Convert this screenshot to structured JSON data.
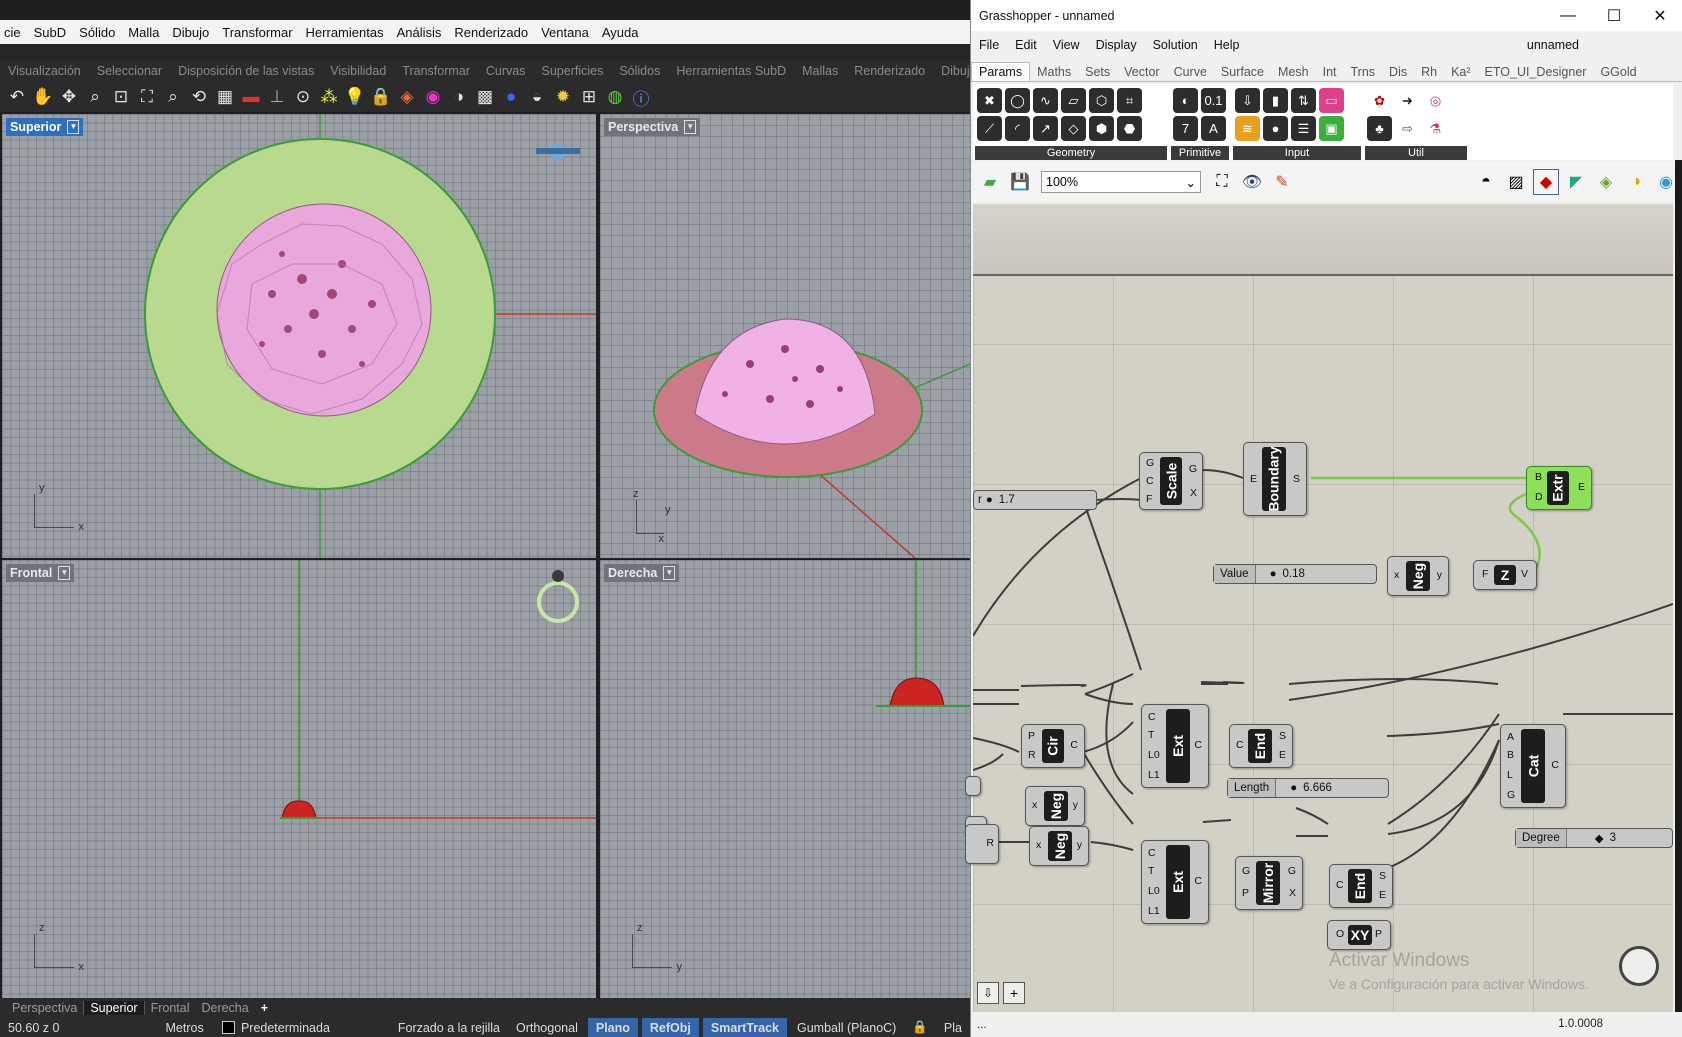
{
  "rhino": {
    "menu": [
      "cie",
      "SubD",
      "Sólido",
      "Malla",
      "Dibujo",
      "Transformar",
      "Herramientas",
      "Análisis",
      "Renderizado",
      "Ventana",
      "Ayuda"
    ],
    "toolbar_tabs": [
      "Visualización",
      "Seleccionar",
      "Disposición de las vistas",
      "Visibilidad",
      "Transformar",
      "Curvas",
      "Superficies",
      "Sólidos",
      "Herramientas SubD",
      "Mallas",
      "Renderizado",
      "Dibujo"
    ],
    "viewports": {
      "top": {
        "label": "Superior",
        "axis_y": "y",
        "axis_x": "x"
      },
      "perspective": {
        "label": "Perspectiva",
        "axis_z": "z",
        "axis_y": "y",
        "axis_x": "x"
      },
      "front": {
        "label": "Frontal",
        "axis_z": "z",
        "axis_x": "x"
      },
      "right": {
        "label": "Derecha",
        "axis_z": "z",
        "axis_y": "y"
      }
    },
    "bottom_tabs": [
      "Perspectiva",
      "Superior",
      "Frontal",
      "Derecha"
    ],
    "add_tab": "+",
    "status": {
      "coords": "50.60  z 0",
      "units": "Metros",
      "layer": "Predeterminada",
      "grid_snap": "Forzado a la rejilla",
      "ortho": "Orthogonal",
      "planar": "Plano",
      "osnap": "RefObj",
      "smarttrack": "SmartTrack",
      "gumball": "Gumball (PlanoC)",
      "tail": "Pla"
    },
    "colors": {
      "active_viewport": "#2f6fc0",
      "status_highlight": "#3365a8",
      "flower": "#e9a8dc",
      "disc": "#b9d98e"
    }
  },
  "gh": {
    "title": "Grasshopper - unnamed",
    "doc_name": "unnamed",
    "menu": [
      "File",
      "Edit",
      "View",
      "Display",
      "Solution",
      "Help"
    ],
    "tabs": [
      "Params",
      "Maths",
      "Sets",
      "Vector",
      "Curve",
      "Surface",
      "Mesh",
      "Int",
      "Trns",
      "Dis",
      "Rh",
      "Ka²",
      "ETO_UI_Designer",
      "GGold"
    ],
    "ribbon_groups": [
      "Geometry",
      "Primitive",
      "Input",
      "Util"
    ],
    "zoom": "100%",
    "nodes": {
      "scale": {
        "name": "Scale",
        "in": [
          "G",
          "C",
          "F"
        ],
        "out": [
          "G",
          "X"
        ]
      },
      "boundary": {
        "name": "Boundary",
        "in": [
          "E"
        ],
        "out": [
          "S"
        ]
      },
      "extr": {
        "name": "Extr",
        "in": [
          "B",
          "D"
        ],
        "out": [
          "E"
        ]
      },
      "neg1": {
        "name": "Neg",
        "in": [
          "x"
        ],
        "out": [
          "y"
        ]
      },
      "unitz": {
        "name": "Z",
        "in": [
          "F"
        ],
        "out": [
          "V"
        ]
      },
      "circle": {
        "name": "Cir",
        "in": [
          "P",
          "R"
        ],
        "out": [
          "C"
        ]
      },
      "ext1": {
        "name": "Ext",
        "in": [
          "C",
          "T",
          "L0",
          "L1"
        ],
        "out": [
          "C"
        ]
      },
      "end1": {
        "name": "End",
        "in": [
          "C"
        ],
        "out": [
          "S",
          "E"
        ]
      },
      "cat": {
        "name": "Cat",
        "in": [
          "A",
          "B",
          "L",
          "G"
        ],
        "out": [
          "C"
        ]
      },
      "neg2": {
        "name": "Neg",
        "in": [
          "x"
        ],
        "out": [
          "y"
        ]
      },
      "ext2": {
        "name": "Ext",
        "in": [
          "C",
          "T",
          "L0",
          "L1"
        ],
        "out": [
          "C"
        ]
      },
      "mirror": {
        "name": "Mirror",
        "in": [
          "G",
          "P"
        ],
        "out": [
          "G",
          "X"
        ]
      },
      "end2": {
        "name": "End",
        "in": [
          "C"
        ],
        "out": [
          "S",
          "E"
        ]
      },
      "neg3": {
        "name": "Neg",
        "in": [
          "x"
        ],
        "out": [
          "y"
        ]
      },
      "r_node": {
        "out": "R"
      },
      "xy": {
        "name": "XY",
        "in": [
          "O"
        ],
        "out": [
          "P"
        ]
      }
    },
    "sliders": {
      "s1": {
        "name": "r",
        "value": "1.7"
      },
      "value": {
        "name": "Value",
        "value": "0.18"
      },
      "length": {
        "name": "Length",
        "value": "6.666"
      },
      "degree": {
        "name": "Degree",
        "value": "3"
      }
    },
    "watermark_title": "Activar Windows",
    "watermark_sub": "Ve a Configuración para activar Windows.",
    "bottom_left": "...",
    "version": "1.0.0008",
    "colors": {
      "canvas": "#d3d0c6",
      "active_node": "#8ee05a"
    }
  }
}
